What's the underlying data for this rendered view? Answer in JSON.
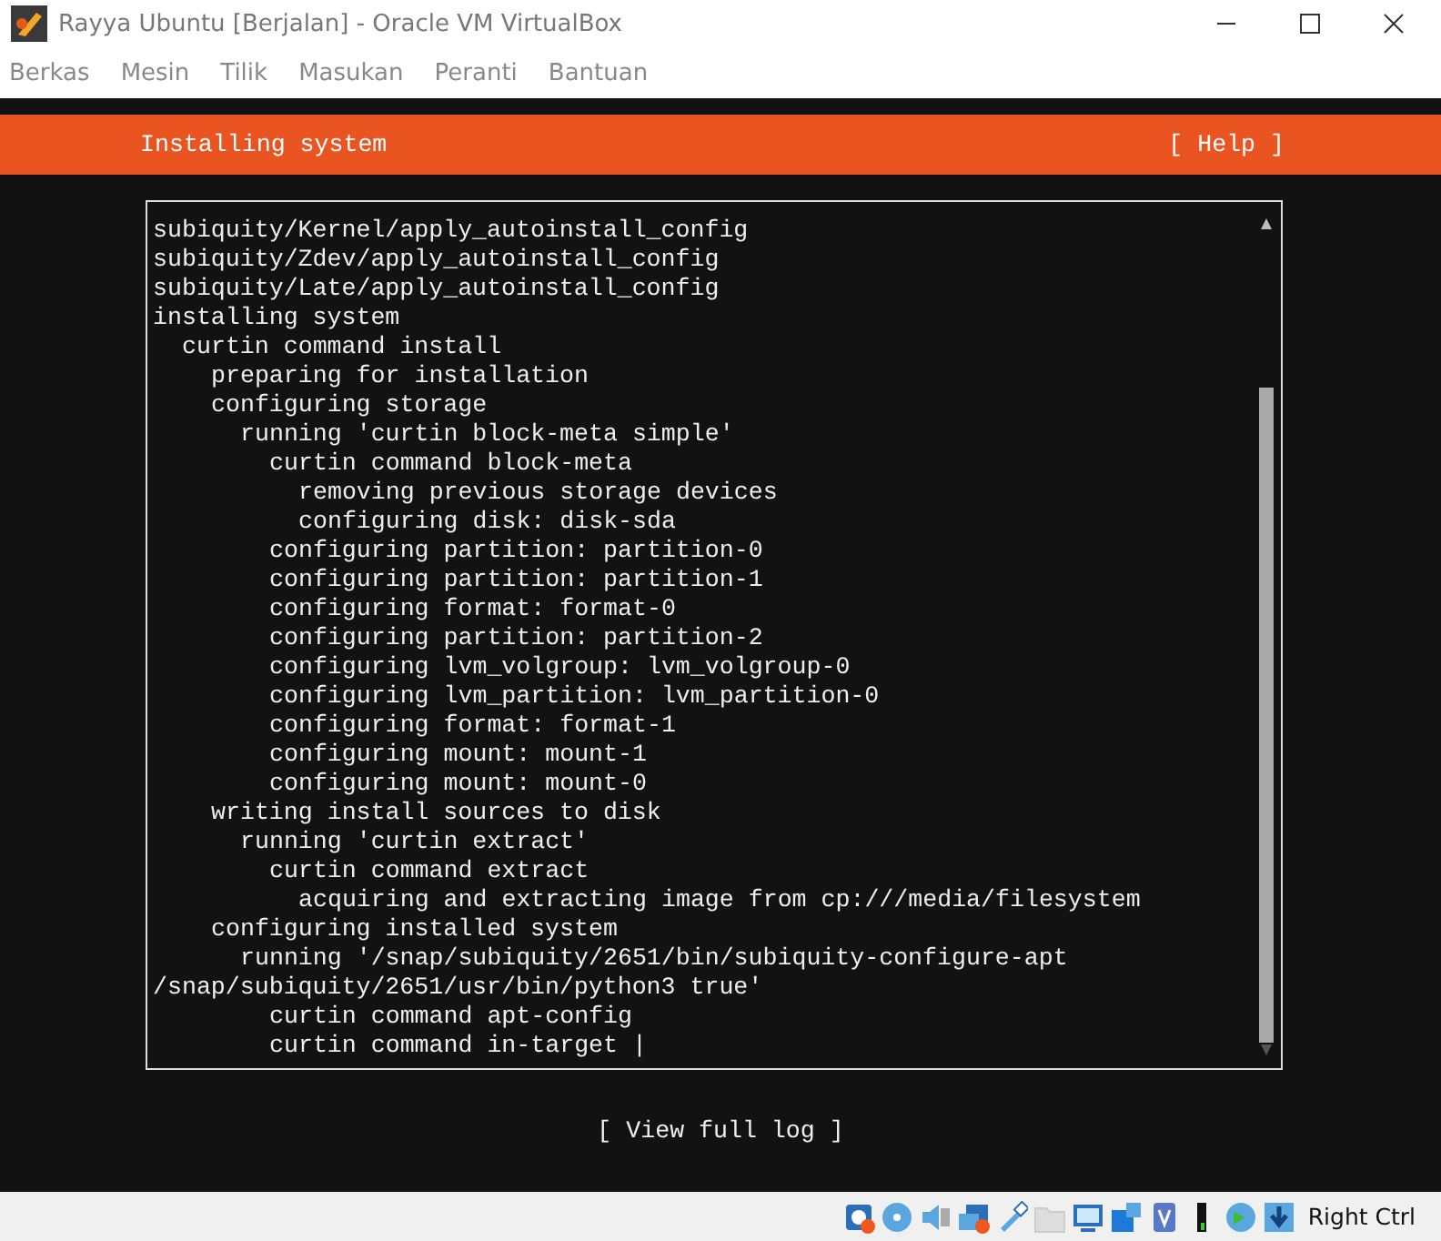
{
  "window": {
    "title": "Rayya Ubuntu [Berjalan] - Oracle VM VirtualBox"
  },
  "menu_bar": [
    "Berkas",
    "Mesin",
    "Tilik",
    "Masukan",
    "Peranti",
    "Bantuan"
  ],
  "header": {
    "title": "Installing system",
    "help_button": "[ Help ]"
  },
  "log": {
    "lines": [
      {
        "text": "subiquity/Kernel/apply_autoinstall_config"
      },
      {
        "text": "subiquity/Zdev/apply_autoinstall_config"
      },
      {
        "text": "subiquity/Late/apply_autoinstall_config"
      },
      {
        "text": "installing system",
        "children": [
          {
            "text": "curtin command install",
            "children": [
              {
                "text": "preparing for installation"
              },
              {
                "text": "configuring storage",
                "children": [
                  {
                    "text": "running 'curtin block-meta simple'",
                    "children": [
                      {
                        "text": "curtin command block-meta",
                        "children": [
                          {
                            "text": "removing previous storage devices"
                          },
                          {
                            "text": "configuring disk: disk-sda"
                          }
                        ]
                      },
                      {
                        "text": "configuring partition: partition-0"
                      },
                      {
                        "text": "configuring partition: partition-1"
                      },
                      {
                        "text": "configuring format: format-0"
                      },
                      {
                        "text": "configuring partition: partition-2"
                      },
                      {
                        "text": "configuring lvm_volgroup: lvm_volgroup-0"
                      },
                      {
                        "text": "configuring lvm_partition: lvm_partition-0"
                      },
                      {
                        "text": "configuring format: format-1"
                      },
                      {
                        "text": "configuring mount: mount-1"
                      },
                      {
                        "text": "configuring mount: mount-0"
                      }
                    ]
                  }
                ]
              },
              {
                "text": "writing install sources to disk",
                "children": [
                  {
                    "text": "running 'curtin extract'",
                    "children": [
                      {
                        "text": "curtin command extract",
                        "children": [
                          {
                            "text": "acquiring and extracting image from cp:///media/filesystem"
                          }
                        ]
                      }
                    ]
                  }
                ]
              },
              {
                "text": "configuring installed system",
                "children": [
                  {
                    "text": "running '/snap/subiquity/2651/bin/subiquity-configure-apt /snap/subiquity/2651/usr/bin/python3 true'",
                    "children": [
                      {
                        "text": "curtin command apt-config"
                      },
                      {
                        "text": "curtin command in-target |"
                      }
                    ]
                  }
                ]
              }
            ]
          }
        ]
      }
    ]
  },
  "buttons": [
    "[ View full log ]"
  ],
  "status_bar": {
    "host_key": "Right Ctrl"
  }
}
